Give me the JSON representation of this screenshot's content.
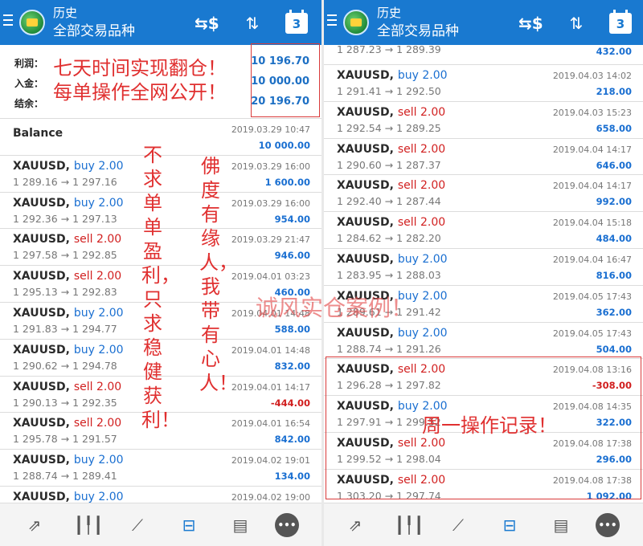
{
  "app": {
    "title": "历史",
    "subtitle": "全部交易品种",
    "calendar_day": "3",
    "icons": [
      "menu-icon",
      "app-logo-icon",
      "dollar-arrows-icon",
      "sort-icon",
      "calendar-icon"
    ]
  },
  "summary": {
    "profit_label": "利润：",
    "deposit_label": "入金：",
    "balance_label": "结余：",
    "profit_value": "10 196.70",
    "deposit_value": "10 000.00",
    "balance_value": "20 196.70"
  },
  "left_rows": [
    {
      "symbol": "Balance",
      "side": "",
      "price": "",
      "time": "2019.03.29 10:47",
      "profit": "10 000.00",
      "neg": false
    },
    {
      "symbol": "XAUUSD,",
      "side": "buy 2.00",
      "price": "1 289.16 → 1 297.16",
      "time": "2019.03.29 16:00",
      "profit": "1 600.00",
      "neg": false
    },
    {
      "symbol": "XAUUSD,",
      "side": "buy 2.00",
      "price": "1 292.36 → 1 297.13",
      "time": "2019.03.29 16:00",
      "profit": "954.00",
      "neg": false
    },
    {
      "symbol": "XAUUSD,",
      "side": "sell 2.00",
      "price": "1 297.58 → 1 292.85",
      "time": "2019.03.29 21:47",
      "profit": "946.00",
      "neg": false
    },
    {
      "symbol": "XAUUSD,",
      "side": "sell 2.00",
      "price": "1 295.13 → 1 292.83",
      "time": "2019.04.01 03:23",
      "profit": "460.00",
      "neg": false
    },
    {
      "symbol": "XAUUSD,",
      "side": "buy 2.00",
      "price": "1 291.83 → 1 294.77",
      "time": "2019.04.01 14:48",
      "profit": "588.00",
      "neg": false
    },
    {
      "symbol": "XAUUSD,",
      "side": "buy 2.00",
      "price": "1 290.62 → 1 294.78",
      "time": "2019.04.01 14:48",
      "profit": "832.00",
      "neg": false
    },
    {
      "symbol": "XAUUSD,",
      "side": "sell 2.00",
      "price": "1 290.13 → 1 292.35",
      "time": "2019.04.01 14:17",
      "profit": "-444.00",
      "neg": true
    },
    {
      "symbol": "XAUUSD,",
      "side": "sell 2.00",
      "price": "1 295.78 → 1 291.57",
      "time": "2019.04.01 16:54",
      "profit": "842.00",
      "neg": false
    },
    {
      "symbol": "XAUUSD,",
      "side": "buy 2.00",
      "price": "1 288.74 → 1 289.41",
      "time": "2019.04.02 19:01",
      "profit": "134.00",
      "neg": false
    },
    {
      "symbol": "XAUUSD,",
      "side": "buy 2.00",
      "price": "",
      "time": "2019.04.02 19:00",
      "profit": "",
      "neg": false
    }
  ],
  "right_top_partial": {
    "price": "1 287.23 → 1 289.39",
    "profit": "432.00"
  },
  "right_rows": [
    {
      "symbol": "XAUUSD,",
      "side": "buy 2.00",
      "price": "1 291.41 → 1 292.50",
      "time": "2019.04.03 14:02",
      "profit": "218.00",
      "neg": false
    },
    {
      "symbol": "XAUUSD,",
      "side": "sell 2.00",
      "price": "1 292.54 → 1 289.25",
      "time": "2019.04.03 15:23",
      "profit": "658.00",
      "neg": false
    },
    {
      "symbol": "XAUUSD,",
      "side": "sell 2.00",
      "price": "1 290.60 → 1 287.37",
      "time": "2019.04.04 14:17",
      "profit": "646.00",
      "neg": false
    },
    {
      "symbol": "XAUUSD,",
      "side": "sell 2.00",
      "price": "1 292.40 → 1 287.44",
      "time": "2019.04.04 14:17",
      "profit": "992.00",
      "neg": false
    },
    {
      "symbol": "XAUUSD,",
      "side": "sell 2.00",
      "price": "1 284.62 → 1 282.20",
      "time": "2019.04.04 15:18",
      "profit": "484.00",
      "neg": false
    },
    {
      "symbol": "XAUUSD,",
      "side": "buy 2.00",
      "price": "1 283.95 → 1 288.03",
      "time": "2019.04.04 16:47",
      "profit": "816.00",
      "neg": false
    },
    {
      "symbol": "XAUUSD,",
      "side": "buy 2.00",
      "price": "1 289.61 → 1 291.42",
      "time": "2019.04.05 17:43",
      "profit": "362.00",
      "neg": false
    },
    {
      "symbol": "XAUUSD,",
      "side": "buy 2.00",
      "price": "1 288.74 → 1 291.26",
      "time": "2019.04.05 17:43",
      "profit": "504.00",
      "neg": false
    },
    {
      "symbol": "XAUUSD,",
      "side": "sell 2.00",
      "price": "1 296.28 → 1 297.82",
      "time": "2019.04.08 13:16",
      "profit": "-308.00",
      "neg": true
    },
    {
      "symbol": "XAUUSD,",
      "side": "buy 2.00",
      "price": "1 297.91 → 1 299.52",
      "time": "2019.04.08 14:35",
      "profit": "322.00",
      "neg": false
    },
    {
      "symbol": "XAUUSD,",
      "side": "sell 2.00",
      "price": "1 299.52 → 1 298.04",
      "time": "2019.04.08 17:38",
      "profit": "296.00",
      "neg": false
    },
    {
      "symbol": "XAUUSD,",
      "side": "sell 2.00",
      "price": "1 303.20 → 1 297.74",
      "time": "2019.04.08 17:38",
      "profit": "1 092.00",
      "neg": false
    }
  ],
  "annotations": {
    "headline1": "七天时间实现翻仓！",
    "headline2": "每单操作全网公开！",
    "col1": "不求单单盈利，只求稳健获利！",
    "col2": "佛度有缘人，我带有心人！",
    "watermark": "诚风实仓案例！",
    "monday": "周一操作记录！"
  },
  "bottom_nav": [
    "trade-icon",
    "chart-candles-icon",
    "trend-icon",
    "history-inbox-icon",
    "news-icon",
    "chat-icon"
  ],
  "colors": {
    "appbar": "#1979d0",
    "buy": "#1a6fd1",
    "sell": "#d11f1f",
    "annotation": "#e03030"
  }
}
